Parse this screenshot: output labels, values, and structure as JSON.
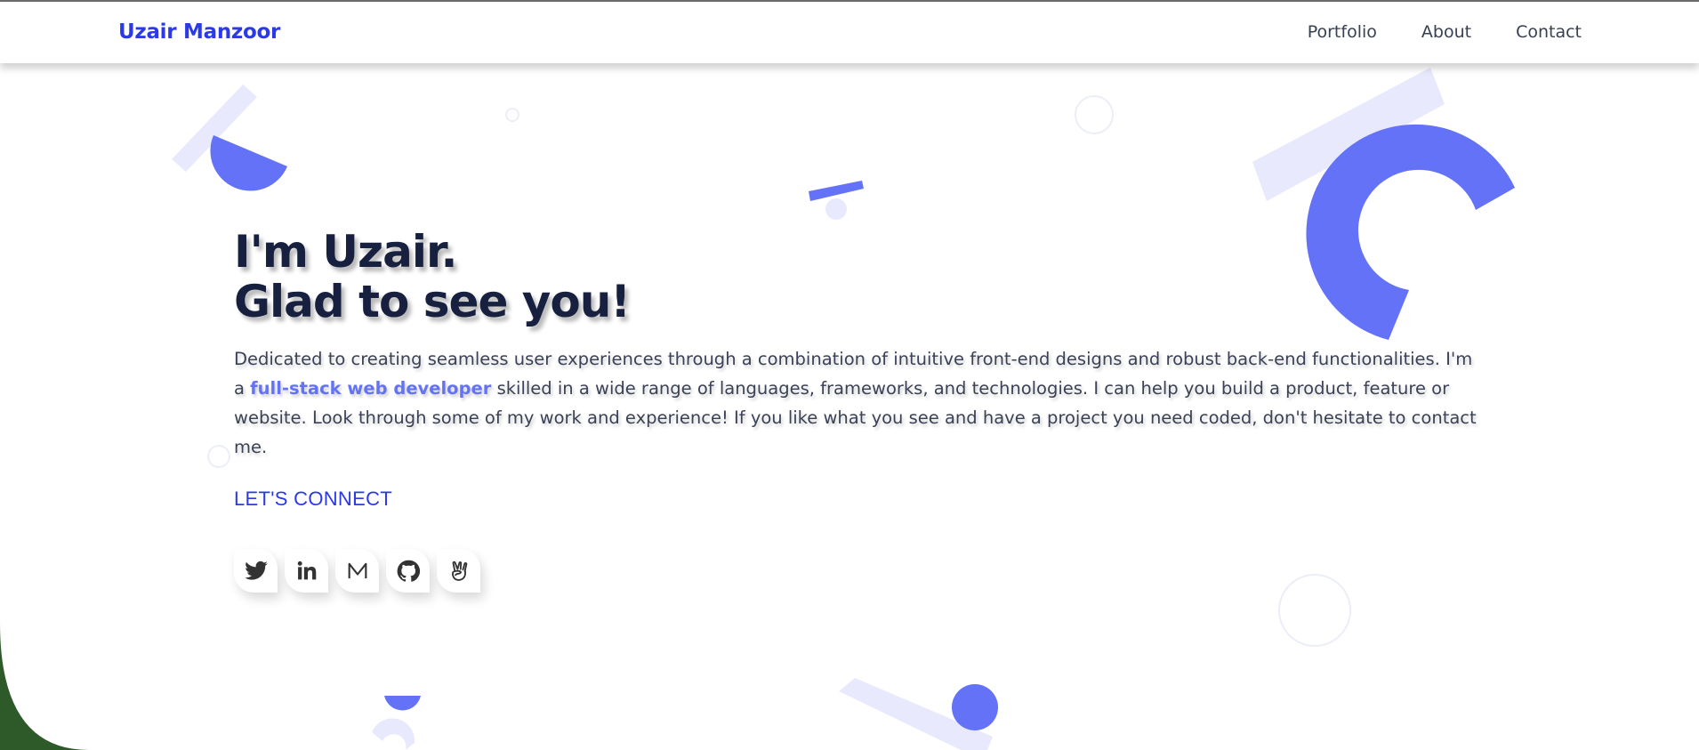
{
  "nav": {
    "brand": "Uzair Manzoor",
    "links": [
      {
        "label": "Portfolio"
      },
      {
        "label": "About"
      },
      {
        "label": "Contact"
      }
    ]
  },
  "hero": {
    "headline_line1": "I'm Uzair.",
    "headline_line2": "Glad to see you!",
    "intro_before": "Dedicated to creating seamless user experiences through a combination of intuitive front-end designs and robust back-end functionalities. I'm a ",
    "intro_highlight": "full-stack web developer",
    "intro_after": " skilled in a wide range of languages, frameworks, and technologies. I can help you build a product, feature or website. Look through some of my work and experience! If you like what you see and have a project you need coded, don't hesitate to contact me.",
    "cta": "LET'S CONNECT"
  },
  "socials": [
    {
      "icon": "twitter-icon"
    },
    {
      "icon": "linkedin-icon"
    },
    {
      "icon": "medium-icon"
    },
    {
      "icon": "github-icon"
    },
    {
      "icon": "angellist-icon"
    }
  ],
  "colors": {
    "accent": "#2b3ae6",
    "shape_primary": "#6372f7",
    "shape_light": "#e8e9fd",
    "heading": "#17213f",
    "corner": "#2e5a2a"
  }
}
